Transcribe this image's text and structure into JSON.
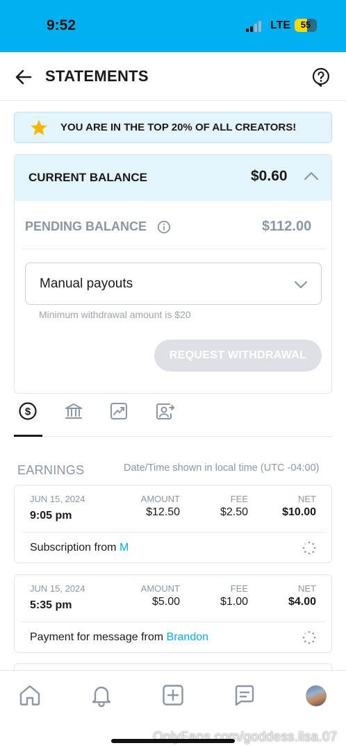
{
  "status_bar": {
    "time": "9:52",
    "network": "LTE",
    "battery": "55",
    "battery_level": 0.55
  },
  "header": {
    "title": "STATEMENTS",
    "back_icon": "arrow-left-icon",
    "help_icon": "question-circle-icon"
  },
  "banner": {
    "icon": "star-icon",
    "text": "YOU ARE IN THE TOP 20% OF ALL CREATORS!"
  },
  "balance": {
    "current_label": "CURRENT BALANCE",
    "current_value": "$0.60",
    "pending_label": "PENDING BALANCE",
    "pending_value": "$112.00",
    "payout_mode": "Manual payouts",
    "min_note": "Minimum withdrawal amount is $20",
    "withdraw_label": "REQUEST WITHDRAWAL"
  },
  "tabs": [
    {
      "icon": "dollar-circle-icon",
      "active": true
    },
    {
      "icon": "bank-icon",
      "active": false
    },
    {
      "icon": "chart-icon",
      "active": false
    },
    {
      "icon": "user-transfer-icon",
      "active": false
    }
  ],
  "earnings": {
    "label": "EARNINGS",
    "timezone_note": "Date/Time shown in local time (UTC -04:00)",
    "col_amount": "AMOUNT",
    "col_fee": "FEE",
    "col_net": "NET",
    "items": [
      {
        "date": "JUN 15, 2024",
        "time": "9:05 pm",
        "amount": "$12.50",
        "fee": "$2.50",
        "net": "$10.00",
        "description": "Subscription from ",
        "from": "M"
      },
      {
        "date": "JUN 15, 2024",
        "time": "5:35 pm",
        "amount": "$5.00",
        "fee": "$1.00",
        "net": "$4.00",
        "description": "Payment for message from ",
        "from": "Brandon"
      }
    ]
  },
  "bottom_nav": {
    "items": [
      "home-icon",
      "bell-icon",
      "plus-square-icon",
      "message-icon",
      "avatar"
    ]
  },
  "watermark": "OnlyFans.com/goddess.lisa.07",
  "colors": {
    "brand": "#00aff0",
    "banner_bg": "#e3f4fc",
    "muted": "#8a96a3",
    "button_disabled": "#dde1e5"
  }
}
